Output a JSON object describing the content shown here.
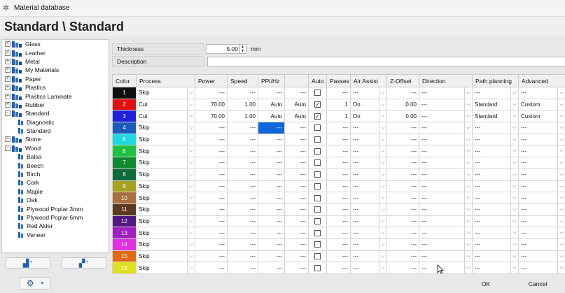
{
  "window": {
    "title": "Material database"
  },
  "header": {
    "title": "Standard \\ Standard"
  },
  "tree": [
    {
      "label": "Glass",
      "level": 0,
      "type": "folder",
      "expander": "+"
    },
    {
      "label": "Leather",
      "level": 0,
      "type": "folder",
      "expander": "+"
    },
    {
      "label": "Metal",
      "level": 0,
      "type": "folder",
      "expander": "+"
    },
    {
      "label": "My Materials",
      "level": 0,
      "type": "folder",
      "expander": "+"
    },
    {
      "label": "Paper",
      "level": 0,
      "type": "folder",
      "expander": "+"
    },
    {
      "label": "Plastics",
      "level": 0,
      "type": "folder",
      "expander": "+"
    },
    {
      "label": "Plastics Laminate",
      "level": 0,
      "type": "folder",
      "expander": "+"
    },
    {
      "label": "Rubber",
      "level": 0,
      "type": "folder",
      "expander": "+"
    },
    {
      "label": "Standard",
      "level": 0,
      "type": "folder",
      "expander": "-"
    },
    {
      "label": "Diagnostic",
      "level": 1,
      "type": "leaf",
      "expander": ""
    },
    {
      "label": "Standard",
      "level": 1,
      "type": "leaf",
      "expander": ""
    },
    {
      "label": "Stone",
      "level": 0,
      "type": "folder",
      "expander": "+"
    },
    {
      "label": "Wood",
      "level": 0,
      "type": "folder",
      "expander": "-"
    },
    {
      "label": "Balsa",
      "level": 1,
      "type": "leaf",
      "expander": ""
    },
    {
      "label": "Beech",
      "level": 1,
      "type": "leaf",
      "expander": ""
    },
    {
      "label": "Birch",
      "level": 1,
      "type": "leaf",
      "expander": ""
    },
    {
      "label": "Cork",
      "level": 1,
      "type": "leaf",
      "expander": ""
    },
    {
      "label": "Maple",
      "level": 1,
      "type": "leaf",
      "expander": ""
    },
    {
      "label": "Oak",
      "level": 1,
      "type": "leaf",
      "expander": ""
    },
    {
      "label": "Plywood Poplar 3mm",
      "level": 1,
      "type": "leaf",
      "expander": ""
    },
    {
      "label": "Plywood Poplar 6mm",
      "level": 1,
      "type": "leaf",
      "expander": ""
    },
    {
      "label": "Red Alder",
      "level": 1,
      "type": "leaf",
      "expander": ""
    },
    {
      "label": "Veneer",
      "level": 1,
      "type": "leaf",
      "expander": ""
    }
  ],
  "fields": {
    "thickness_label": "Thickness",
    "thickness_value": "5.00",
    "thickness_unit": "mm",
    "description_label": "Description",
    "description_value": ""
  },
  "columns": [
    "Color",
    "Process",
    "Power",
    "Speed",
    "PPI/Hz",
    "",
    "Auto",
    "Passes",
    "Air Assist",
    "Z-Offset",
    "Direction",
    "Path planning",
    "Advanced"
  ],
  "rows": [
    {
      "num": "1",
      "color": "#101010",
      "process": "Skip",
      "power": "---",
      "speed": "---",
      "ppi": "---",
      "extra": "---",
      "auto": "",
      "passes": "---",
      "air": "---",
      "z": "---",
      "direction": "---",
      "path": "---",
      "advanced": "---"
    },
    {
      "num": "2",
      "color": "#e01010",
      "process": "Cut",
      "power": "70.00",
      "speed": "1.00",
      "ppi": "Auto",
      "extra": "Auto",
      "auto": "✓",
      "passes": "1",
      "air": "On",
      "z": "0.00",
      "direction": "---",
      "path": "Standard",
      "advanced": "Custom"
    },
    {
      "num": "3",
      "color": "#2020d8",
      "process": "Cut",
      "power": "70.00",
      "speed": "1.00",
      "ppi": "Auto",
      "extra": "Auto",
      "auto": "✓",
      "passes": "1",
      "air": "On",
      "z": "0.00",
      "direction": "---",
      "path": "Standard",
      "advanced": "Custom"
    },
    {
      "num": "4",
      "color": "#1a5ab8",
      "process": "Skip",
      "power": "---",
      "speed": "---",
      "ppi": "---",
      "extra": "---",
      "auto": "",
      "passes": "---",
      "air": "---",
      "z": "---",
      "direction": "---",
      "path": "---",
      "advanced": "---"
    },
    {
      "num": "5",
      "color": "#20d8e0",
      "process": "Skip",
      "power": "---",
      "speed": "---",
      "ppi": "---",
      "extra": "---",
      "auto": "",
      "passes": "---",
      "air": "---",
      "z": "---",
      "direction": "---",
      "path": "---",
      "advanced": "---"
    },
    {
      "num": "6",
      "color": "#20c040",
      "process": "Skip",
      "power": "---",
      "speed": "---",
      "ppi": "---",
      "extra": "---",
      "auto": "",
      "passes": "---",
      "air": "---",
      "z": "---",
      "direction": "---",
      "path": "---",
      "advanced": "---"
    },
    {
      "num": "7",
      "color": "#108a30",
      "process": "Skip",
      "power": "---",
      "speed": "---",
      "ppi": "---",
      "extra": "---",
      "auto": "",
      "passes": "---",
      "air": "---",
      "z": "---",
      "direction": "---",
      "path": "---",
      "advanced": "---"
    },
    {
      "num": "8",
      "color": "#0e6a38",
      "process": "Skip",
      "power": "---",
      "speed": "---",
      "ppi": "---",
      "extra": "---",
      "auto": "",
      "passes": "---",
      "air": "---",
      "z": "---",
      "direction": "---",
      "path": "---",
      "advanced": "---"
    },
    {
      "num": "9",
      "color": "#a8a020",
      "process": "Skip",
      "power": "---",
      "speed": "---",
      "ppi": "---",
      "extra": "---",
      "auto": "",
      "passes": "---",
      "air": "---",
      "z": "---",
      "direction": "---",
      "path": "---",
      "advanced": "---"
    },
    {
      "num": "10",
      "color": "#a87040",
      "process": "Skip",
      "power": "---",
      "speed": "---",
      "ppi": "---",
      "extra": "---",
      "auto": "",
      "passes": "---",
      "air": "---",
      "z": "---",
      "direction": "---",
      "path": "---",
      "advanced": "---"
    },
    {
      "num": "11",
      "color": "#5a3a20",
      "process": "Skip",
      "power": "---",
      "speed": "---",
      "ppi": "---",
      "extra": "---",
      "auto": "",
      "passes": "---",
      "air": "---",
      "z": "---",
      "direction": "---",
      "path": "---",
      "advanced": "---"
    },
    {
      "num": "12",
      "color": "#501880",
      "process": "Skip",
      "power": "---",
      "speed": "---",
      "ppi": "---",
      "extra": "---",
      "auto": "",
      "passes": "---",
      "air": "---",
      "z": "---",
      "direction": "---",
      "path": "---",
      "advanced": "---"
    },
    {
      "num": "13",
      "color": "#a020c0",
      "process": "Skip",
      "power": "---",
      "speed": "---",
      "ppi": "---",
      "extra": "---",
      "auto": "",
      "passes": "---",
      "air": "---",
      "z": "---",
      "direction": "---",
      "path": "---",
      "advanced": "---"
    },
    {
      "num": "14",
      "color": "#e030e0",
      "process": "Skip",
      "power": "---",
      "speed": "---",
      "ppi": "---",
      "extra": "---",
      "auto": "",
      "passes": "---",
      "air": "---",
      "z": "---",
      "direction": "---",
      "path": "---",
      "advanced": "---"
    },
    {
      "num": "15",
      "color": "#e06a10",
      "process": "Skip",
      "power": "---",
      "speed": "---",
      "ppi": "---",
      "extra": "---",
      "auto": "",
      "passes": "---",
      "air": "---",
      "z": "---",
      "direction": "---",
      "path": "---",
      "advanced": "---"
    },
    {
      "num": "16",
      "color": "#e0e020",
      "process": "Skip",
      "power": "---",
      "speed": "---",
      "ppi": "---",
      "extra": "---",
      "auto": "",
      "passes": "---",
      "air": "---",
      "z": "---",
      "direction": "---",
      "path": "---",
      "advanced": "---"
    }
  ],
  "buttons": {
    "ok": "OK",
    "cancel": "Cancel"
  },
  "icons": {
    "app": "gear-icon",
    "add_folder": "add-folder-icon",
    "add_material": "add-material-icon",
    "settings": "settings-gear-icon"
  }
}
